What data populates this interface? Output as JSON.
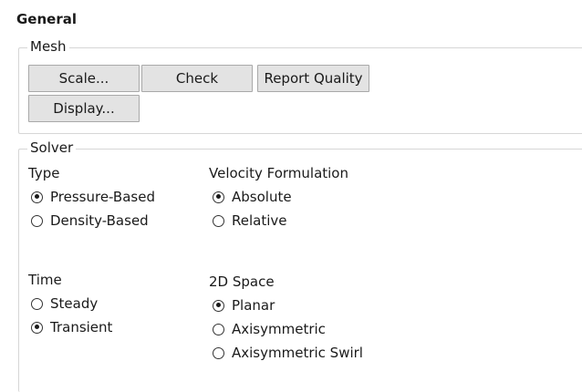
{
  "panel": {
    "title": "General"
  },
  "mesh": {
    "legend": "Mesh",
    "buttons": {
      "scale": "Scale...",
      "check": "Check",
      "report_quality": "Report Quality",
      "display": "Display..."
    }
  },
  "solver": {
    "legend": "Solver",
    "type": {
      "label": "Type",
      "options": [
        {
          "label": "Pressure-Based",
          "selected": true
        },
        {
          "label": "Density-Based",
          "selected": false
        }
      ]
    },
    "velocity_formulation": {
      "label": "Velocity Formulation",
      "options": [
        {
          "label": "Absolute",
          "selected": true
        },
        {
          "label": "Relative",
          "selected": false
        }
      ]
    },
    "time": {
      "label": "Time",
      "options": [
        {
          "label": "Steady",
          "selected": false
        },
        {
          "label": "Transient",
          "selected": true
        }
      ]
    },
    "space_2d": {
      "label": "2D Space",
      "options": [
        {
          "label": "Planar",
          "selected": true
        },
        {
          "label": "Axisymmetric",
          "selected": false
        },
        {
          "label": "Axisymmetric Swirl",
          "selected": false
        }
      ]
    }
  }
}
